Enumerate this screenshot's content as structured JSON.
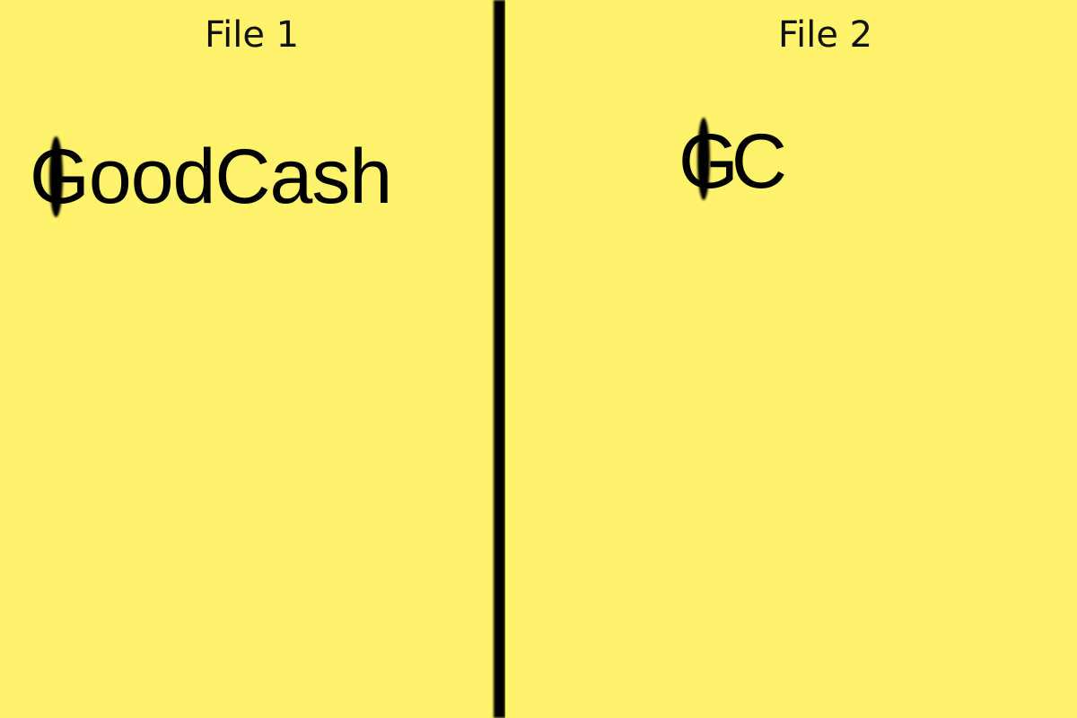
{
  "panels": {
    "left": {
      "title": "File 1",
      "logo_text": "GoodCash"
    },
    "right": {
      "title": "File 2",
      "logo_text": "GC"
    }
  },
  "colors": {
    "background": "#fff36b",
    "text": "#000000",
    "divider": "#000000"
  },
  "icons": {
    "cursor_mark": "text-cursor-icon"
  }
}
